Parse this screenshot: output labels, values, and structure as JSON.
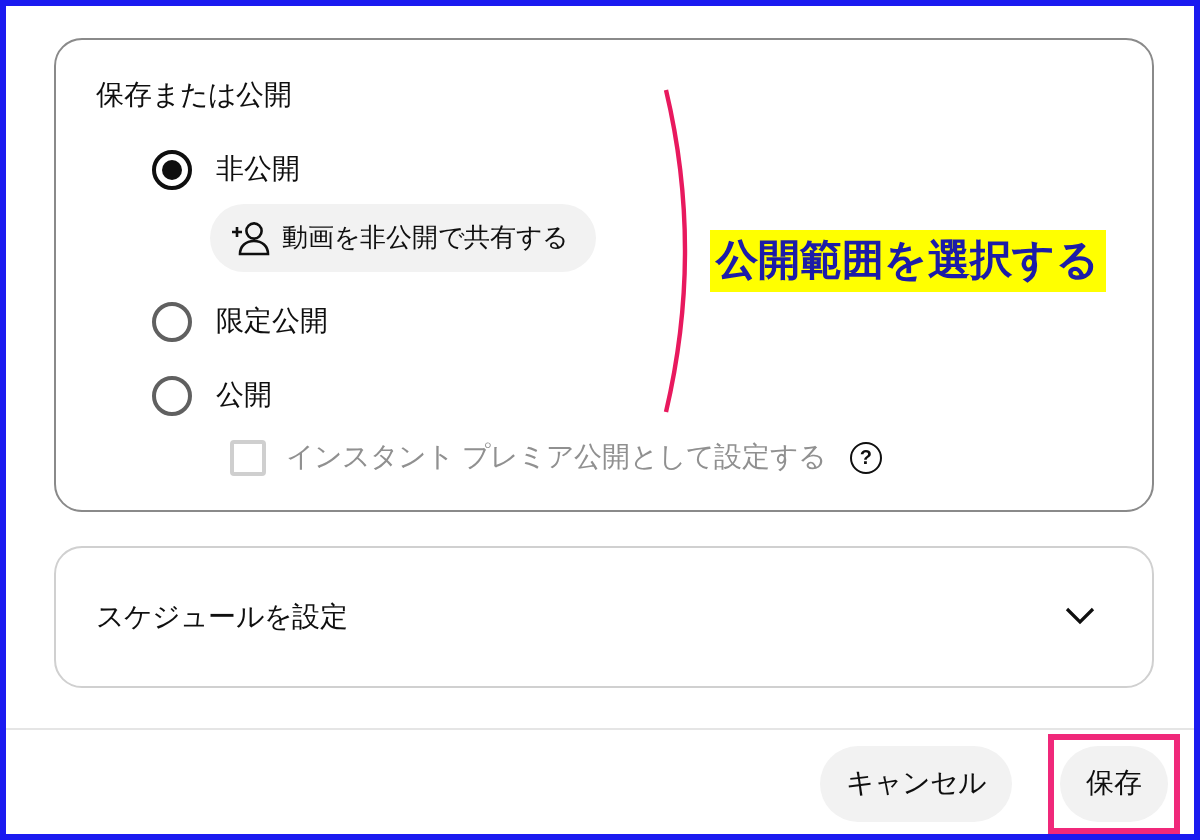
{
  "visibility": {
    "title": "保存または公開",
    "options": [
      {
        "label": "非公開",
        "selected": true,
        "chip": "動画を非公開で共有する"
      },
      {
        "label": "限定公開",
        "selected": false
      },
      {
        "label": "公開",
        "selected": false
      }
    ],
    "premiere": {
      "label": "インスタント プレミア公開として設定する",
      "checked": false,
      "disabled": true,
      "help": "?"
    }
  },
  "annotation": {
    "text": "公開範囲を選択する"
  },
  "schedule": {
    "title": "スケジュールを設定",
    "expanded": false
  },
  "buttons": [
    {
      "label": "キャンセル",
      "highlighted": false
    },
    {
      "label": "保存",
      "highlighted": true
    }
  ]
}
